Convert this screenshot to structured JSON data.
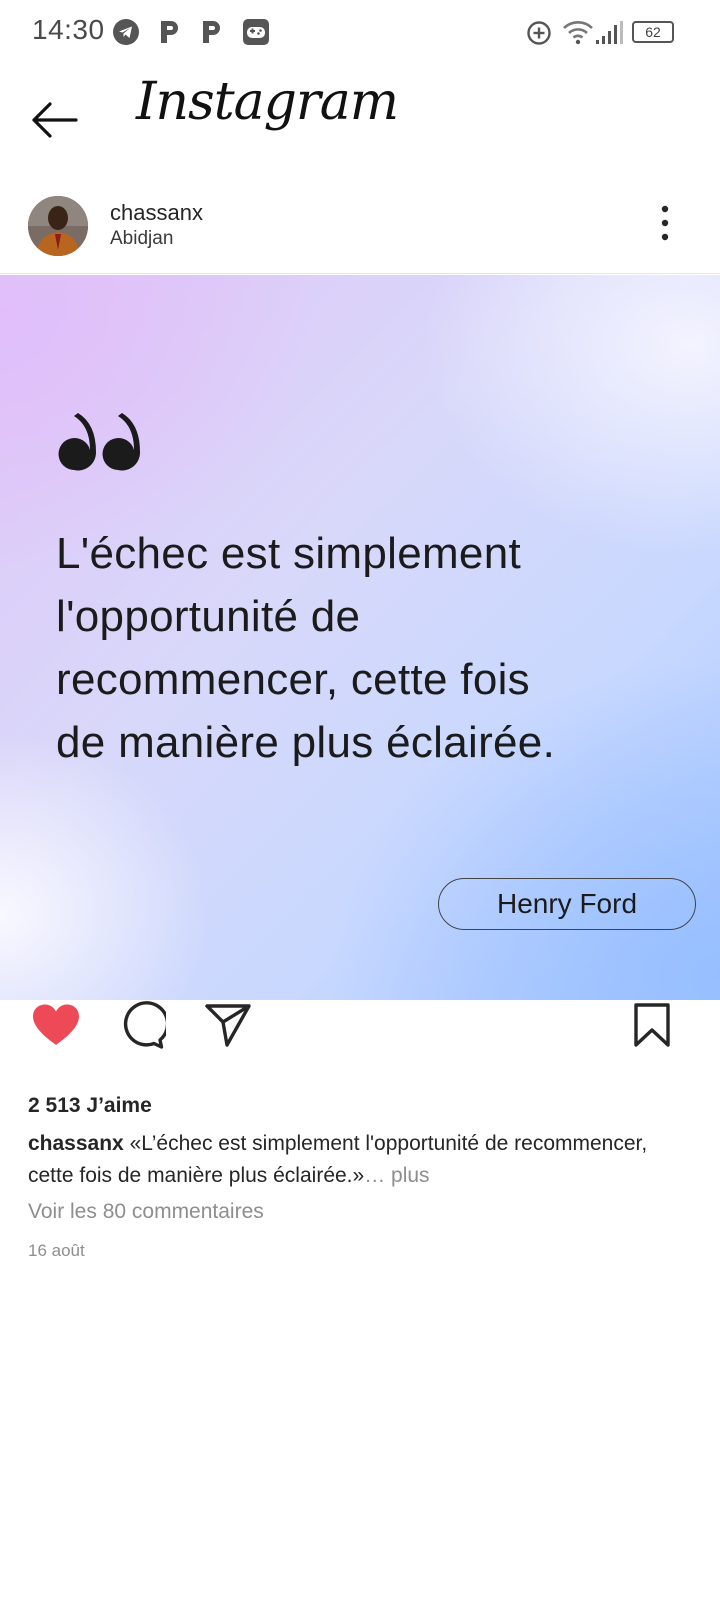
{
  "status_bar": {
    "time": "14:30",
    "battery": "62",
    "left_icons": [
      "telegram-icon",
      "p-app-icon",
      "p-app-icon",
      "game-controller-icon"
    ],
    "right_icons": [
      "data-saver-icon",
      "wifi-icon",
      "signal-icon",
      "battery-icon"
    ]
  },
  "app_bar": {
    "title": "Instagram"
  },
  "post": {
    "username": "chassanx",
    "location": "Abidjan",
    "quote_lines": [
      "L'échec est simplement",
      "l'opportunité de",
      "recommencer, cette fois",
      "de manière plus éclairée."
    ],
    "author": "Henry Ford",
    "liked": true,
    "like_color": "#ed4956",
    "likes_text": "2 513 J’aime",
    "caption_user": "chassanx",
    "caption_text": " «L’échec est simplement l'opportunité de recommencer, cette fois de manière plus éclairée.»",
    "caption_more": "… plus",
    "view_comments": "Voir les 80 commentaires",
    "date": "16 août"
  }
}
